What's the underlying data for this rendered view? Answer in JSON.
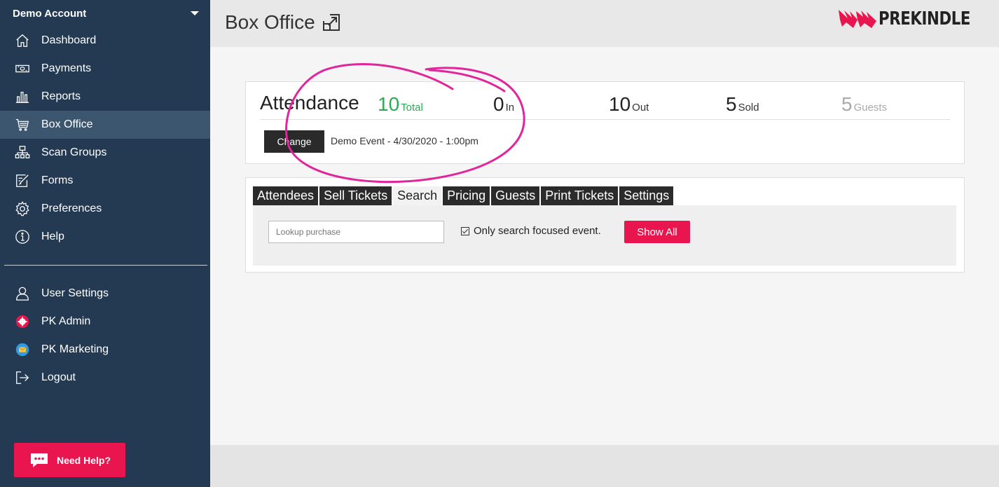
{
  "sidebar": {
    "account": "Demo Account",
    "items": [
      {
        "label": "Dashboard",
        "icon": "home-icon"
      },
      {
        "label": "Payments",
        "icon": "money-icon"
      },
      {
        "label": "Reports",
        "icon": "bar-chart-icon"
      },
      {
        "label": "Box Office",
        "icon": "cart-icon"
      },
      {
        "label": "Scan Groups",
        "icon": "network-icon"
      },
      {
        "label": "Forms",
        "icon": "form-edit-icon"
      },
      {
        "label": "Preferences",
        "icon": "gear-icon"
      },
      {
        "label": "Help",
        "icon": "info-icon"
      }
    ],
    "items2": [
      {
        "label": "User Settings",
        "icon": "user-icon"
      },
      {
        "label": "PK Admin",
        "icon": "admin-gear-icon"
      },
      {
        "label": "PK Marketing",
        "icon": "marketing-mail-icon"
      },
      {
        "label": "Logout",
        "icon": "logout-icon"
      }
    ],
    "active": "Box Office",
    "need_help": "Need Help?"
  },
  "header": {
    "title": "Box Office",
    "logo": "PREKINDLE"
  },
  "attendance": {
    "title": "Attendance",
    "total_value": "10",
    "total_label": "Total",
    "in_value": "0",
    "in_label": "In",
    "out_value": "10",
    "out_label": "Out",
    "sold_value": "5",
    "sold_label": "Sold",
    "guests_value": "5",
    "guests_label": "Guests",
    "change_label": "Change",
    "event": "Demo Event - 4/30/2020 - 1:00pm"
  },
  "tabs": [
    "Attendees",
    "Sell Tickets",
    "Search",
    "Pricing",
    "Guests",
    "Print Tickets",
    "Settings"
  ],
  "active_tab": "Search",
  "search": {
    "placeholder": "Lookup purchase",
    "checkbox_label": "Only search focused event.",
    "checkbox_checked": true,
    "show_all": "Show All"
  },
  "colors": {
    "sidebar": "#243a53",
    "accent": "#e8154f",
    "total_green": "#2eaa55",
    "annotation": "#e0269a"
  }
}
